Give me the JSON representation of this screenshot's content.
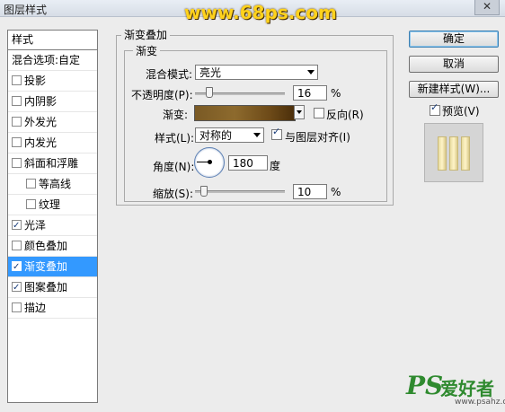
{
  "window": {
    "title": "图层样式",
    "close_label": "✕"
  },
  "watermark": "www.68ps.com",
  "styles_list": {
    "header": "样式",
    "blend_options": "混合选项:自定",
    "items": [
      {
        "label": "投影",
        "checked": false,
        "sub": false
      },
      {
        "label": "内阴影",
        "checked": false,
        "sub": false
      },
      {
        "label": "外发光",
        "checked": false,
        "sub": false
      },
      {
        "label": "内发光",
        "checked": false,
        "sub": false
      },
      {
        "label": "斜面和浮雕",
        "checked": false,
        "sub": false
      },
      {
        "label": "等高线",
        "checked": false,
        "sub": true
      },
      {
        "label": "纹理",
        "checked": false,
        "sub": true
      },
      {
        "label": "光泽",
        "checked": true,
        "sub": false
      },
      {
        "label": "颜色叠加",
        "checked": false,
        "sub": false
      },
      {
        "label": "渐变叠加",
        "checked": true,
        "sub": false,
        "selected": true
      },
      {
        "label": "图案叠加",
        "checked": true,
        "sub": false
      },
      {
        "label": "描边",
        "checked": false,
        "sub": false
      }
    ]
  },
  "panel": {
    "title": "渐变叠加",
    "group_title": "渐变",
    "blend_mode_label": "混合模式:",
    "blend_mode_value": "亮光",
    "opacity_label": "不透明度(P):",
    "opacity_value": "16",
    "opacity_unit": "%",
    "opacity_level": 0.16,
    "gradient_label": "渐变:",
    "reverse_label": "反向(R)",
    "reverse_checked": false,
    "style_label": "样式(L):",
    "style_value": "对称的",
    "align_label": "与图层对齐(I)",
    "align_checked": true,
    "angle_label": "角度(N):",
    "angle_value": "180",
    "angle_unit": "度",
    "scale_label": "缩放(S):",
    "scale_value": "10",
    "scale_unit": "%",
    "scale_level": 0.1
  },
  "buttons": {
    "ok": "确定",
    "cancel": "取消",
    "new_style": "新建样式(W)...",
    "preview_label": "预览(V)",
    "preview_checked": true
  },
  "brand": {
    "ps": "PS",
    "cn": "爱好者",
    "url": "www.psahz.com"
  }
}
